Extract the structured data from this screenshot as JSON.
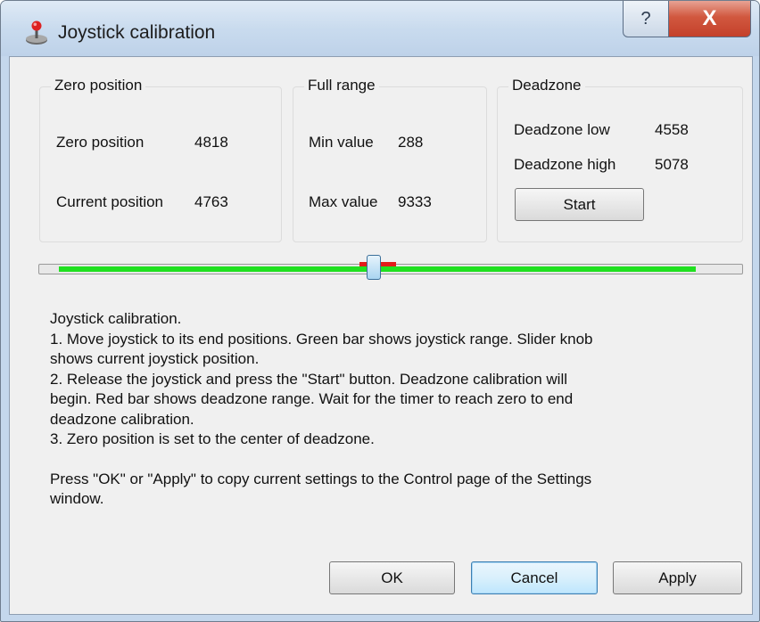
{
  "window": {
    "title": "Joystick calibration",
    "help_glyph": "?",
    "close_glyph": "X",
    "icon": "joystick-icon"
  },
  "groups": {
    "zero": {
      "title": "Zero position",
      "zero_label": "Zero position",
      "zero_value": "4818",
      "current_label": "Current position",
      "current_value": "4763"
    },
    "range": {
      "title": "Full range",
      "min_label": "Min value",
      "min_value": "288",
      "max_label": "Max value",
      "max_value": "9333"
    },
    "deadzone": {
      "title": "Deadzone",
      "low_label": "Deadzone low",
      "low_value": "4558",
      "high_label": "Deadzone high",
      "high_value": "5078",
      "start_label": "Start"
    }
  },
  "slider": {
    "scale_max": 10000,
    "range_min": 288,
    "range_max": 9333,
    "deadzone_low": 4558,
    "deadzone_high": 5078,
    "position": 4763,
    "green_color": "#20e020",
    "red_color": "#e21a1a"
  },
  "instructions": {
    "lines": [
      "Joystick calibration.",
      "1. Move joystick to its end positions. Green bar shows joystick range. Slider knob",
      "shows current joystick position.",
      "2. Release the joystick and press the \"Start\" button. Deadzone calibration will",
      "begin. Red bar shows deadzone range. Wait for the timer to reach zero to end",
      "deadzone calibration.",
      "3. Zero position is set to the center of deadzone."
    ],
    "footer_lines": [
      "Press \"OK\" or \"Apply\" to copy current settings to the Control page of the Settings",
      "window."
    ]
  },
  "buttons": {
    "ok": "OK",
    "cancel": "Cancel",
    "apply": "Apply"
  }
}
